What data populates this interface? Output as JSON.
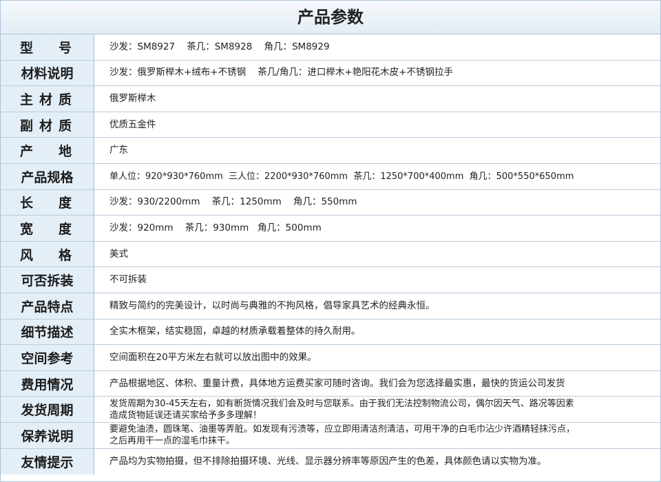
{
  "title": "产品参数",
  "rows": [
    {
      "label": "型号",
      "value": "沙发：SM8927    茶几：SM8928    角几：SM8929"
    },
    {
      "label": "材料说明",
      "value": "沙发：俄罗斯榉木+绒布+不锈钢    茶几/角几：进口榉木+艳阳花木皮+不锈钢拉手"
    },
    {
      "label": "主材质",
      "value": "俄罗斯榉木"
    },
    {
      "label": "副材质",
      "value": "优质五金件"
    },
    {
      "label": "产地",
      "value": "广东"
    },
    {
      "label": "产品规格",
      "value": "单人位：920*930*760mm  三人位：2200*930*760mm  茶几：1250*700*400mm  角几：500*550*650mm"
    },
    {
      "label": "长度",
      "value": "沙发：930/2200mm    茶几：1250mm    角几：550mm"
    },
    {
      "label": "宽度",
      "value": "沙发：920mm    茶几：930mm   角几：500mm"
    },
    {
      "label": "风格",
      "value": "美式"
    },
    {
      "label": "可否拆装",
      "value": "不可拆装"
    },
    {
      "label": "产品特点",
      "value": "精致与简约的完美设计，以时尚与典雅的不拘风格，倡导家具艺术的经典永恒。"
    },
    {
      "label": "细节描述",
      "value": "全实木框架，结实稳固，卓越的材质承载着整体的持久耐用。"
    },
    {
      "label": "空间参考",
      "value": "空间面积在20平方米左右就可以放出图中的效果。"
    },
    {
      "label": "费用情况",
      "value": "产品根据地区、体积、重量计费，具体地方运费买家可随时咨询。我们会为您选择最实惠，最快的货运公司发货"
    },
    {
      "label": "发货周期",
      "value": "发货周期为30-45天左右，如有断货情况我们会及时与您联系。由于我们无法控制物流公司，偶尔因天气、路况等因素\n造成货物延误还请买家给予多多理解！"
    },
    {
      "label": "保养说明",
      "value": "要避免油渍，圆珠笔、油墨等弄脏。如发现有污渍等，应立即用清洁剂清洁，可用干净的白毛巾沾少许酒精轻抹污点，\n之后再用干一点的湿毛巾抹干。"
    },
    {
      "label": "友情提示",
      "value": "产品均为实物拍摄，但不排除拍摄环境、光线、显示器分辨率等原因产生的色差，具体颜色请以实物为准。"
    }
  ]
}
